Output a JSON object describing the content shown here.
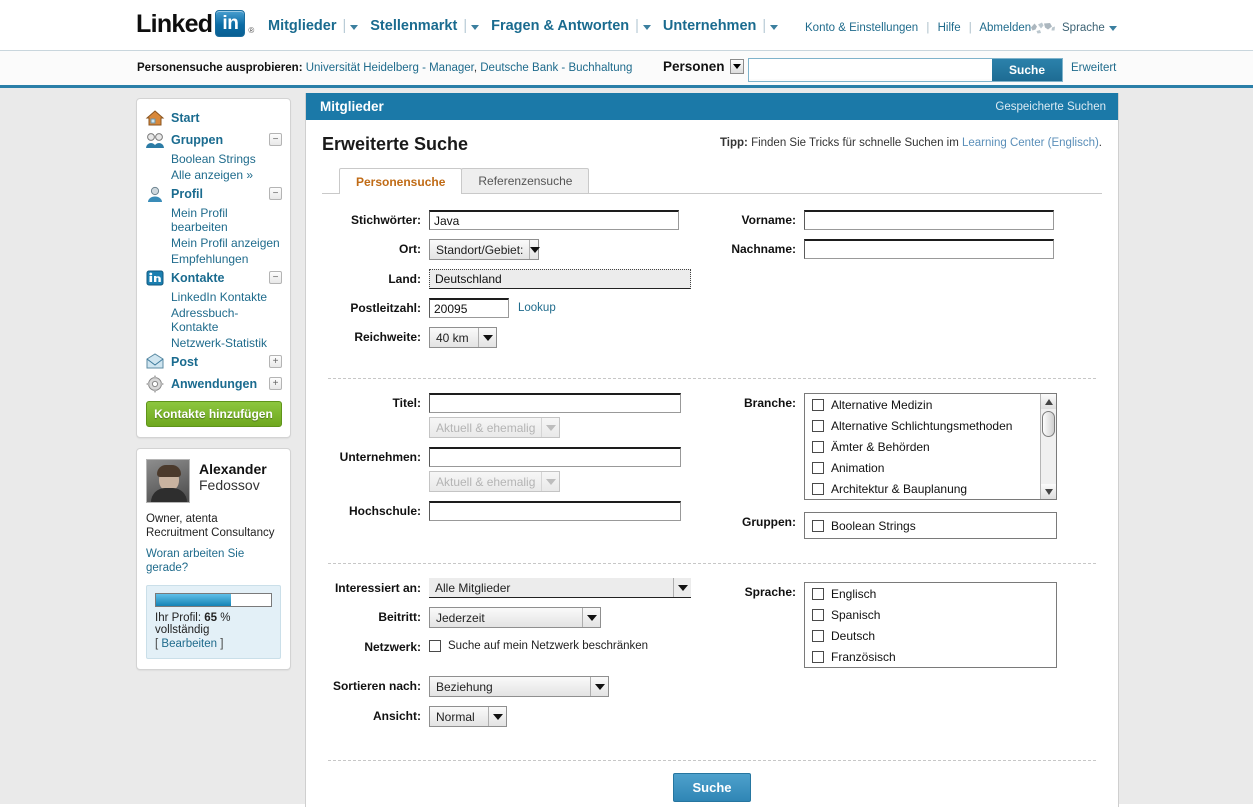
{
  "brand": {
    "logo_word": "Linked",
    "logo_badge": "in",
    "logo_reg": "®",
    "accent_blue": "#1b79a8",
    "link_blue": "#1f6b8c",
    "tab_orange": "#c06b16",
    "green_button": "#8cc63e"
  },
  "topnav": {
    "items": [
      {
        "label": "Mitglieder"
      },
      {
        "label": "Stellenmarkt"
      },
      {
        "label": "Fragen & Antworten"
      },
      {
        "label": "Unternehmen"
      }
    ],
    "account_links": [
      {
        "label": "Konto & Einstellungen"
      },
      {
        "label": "Hilfe"
      },
      {
        "label": "Abmelden"
      }
    ],
    "language_label": "Sprache",
    "globe_icon": "globe-icon"
  },
  "searchbar": {
    "try_prefix": "Personensuche ausprobieren:",
    "try_links": [
      "Universität Heidelberg - Manager",
      "Deutsche Bank - Buchhaltung"
    ],
    "try_separator": ",",
    "scope_label": "Personen",
    "input_value": "",
    "input_placeholder": "",
    "search_button": "Suche",
    "advanced_link": "Erweitert"
  },
  "sidebar": {
    "nav": [
      {
        "label": "Start",
        "icon": "home-icon",
        "toggle": null,
        "children": []
      },
      {
        "label": "Gruppen",
        "icon": "group-icon",
        "toggle": "−",
        "children": [
          "Boolean Strings",
          "Alle anzeigen »"
        ]
      },
      {
        "label": "Profil",
        "icon": "person-icon",
        "toggle": "−",
        "children": [
          "Mein Profil bearbeiten",
          "Mein Profil anzeigen",
          "Empfehlungen"
        ]
      },
      {
        "label": "Kontakte",
        "icon": "contacts-icon",
        "toggle": "−",
        "children": [
          "LinkedIn Kontakte",
          "Adressbuch-Kontakte",
          "Netzwerk-Statistik"
        ]
      },
      {
        "label": "Post",
        "icon": "mail-icon",
        "toggle": "+",
        "children": []
      },
      {
        "label": "Anwendungen",
        "icon": "gear-icon",
        "toggle": "+",
        "children": []
      }
    ],
    "add_contacts_button": "Kontakte hinzufügen",
    "profile": {
      "first_name": "Alexander",
      "last_name": "Fedossov",
      "headline": "Owner, atenta Recruitment Consultancy",
      "status_prompt": "Woran arbeiten Sie gerade?",
      "progress_percent": 65,
      "progress_prefix": "Ihr Profil:",
      "progress_value": "65",
      "progress_suffix": "% vollständig",
      "edit_open": "[",
      "edit_label": "Bearbeiten",
      "edit_close": "]"
    }
  },
  "main": {
    "header_title": "Mitglieder",
    "saved_searches": "Gespeicherte Suchen",
    "page_title": "Erweiterte Suche",
    "tip": {
      "bold": "Tipp:",
      "text": "Finden Sie Tricks für schnelle Suchen im",
      "link": "Learning Center (Englisch)",
      "period": "."
    },
    "tabs": [
      {
        "label": "Personensuche",
        "active": true
      },
      {
        "label": "Referenzensuche",
        "active": false
      }
    ],
    "form": {
      "section1": {
        "keywords_label": "Stichwörter:",
        "keywords_value": "Java",
        "location_label": "Ort:",
        "location_value": "Standort/Gebiet:",
        "country_label": "Land:",
        "country_value": "Deutschland",
        "postal_label": "Postleitzahl:",
        "postal_value": "20095",
        "lookup_link": "Lookup",
        "radius_label": "Reichweite:",
        "radius_value": "40 km",
        "firstname_label": "Vorname:",
        "firstname_value": "",
        "lastname_label": "Nachname:",
        "lastname_value": ""
      },
      "section2": {
        "title_label": "Titel:",
        "title_value": "",
        "title_scope": "Aktuell & ehemalig",
        "company_label": "Unternehmen:",
        "company_value": "",
        "company_scope": "Aktuell & ehemalig",
        "school_label": "Hochschule:",
        "school_value": "",
        "industry_label": "Branche:",
        "industry_options": [
          "Alternative Medizin",
          "Alternative Schlichtungsmethoden",
          "Ämter & Behörden",
          "Animation",
          "Architektur & Bauplanung"
        ],
        "groups_label": "Gruppen:",
        "groups_options": [
          "Boolean Strings"
        ]
      },
      "section3": {
        "interested_label": "Interessiert an:",
        "interested_value": "Alle Mitglieder",
        "joined_label": "Beitritt:",
        "joined_value": "Jederzeit",
        "network_label": "Netzwerk:",
        "network_checkbox_label": "Suche auf mein Netzwerk beschränken",
        "sort_label": "Sortieren nach:",
        "sort_value": "Beziehung",
        "view_label": "Ansicht:",
        "view_value": "Normal",
        "language_label": "Sprache:",
        "language_options": [
          "Englisch",
          "Spanisch",
          "Deutsch",
          "Französisch"
        ]
      },
      "submit_button": "Suche"
    }
  }
}
